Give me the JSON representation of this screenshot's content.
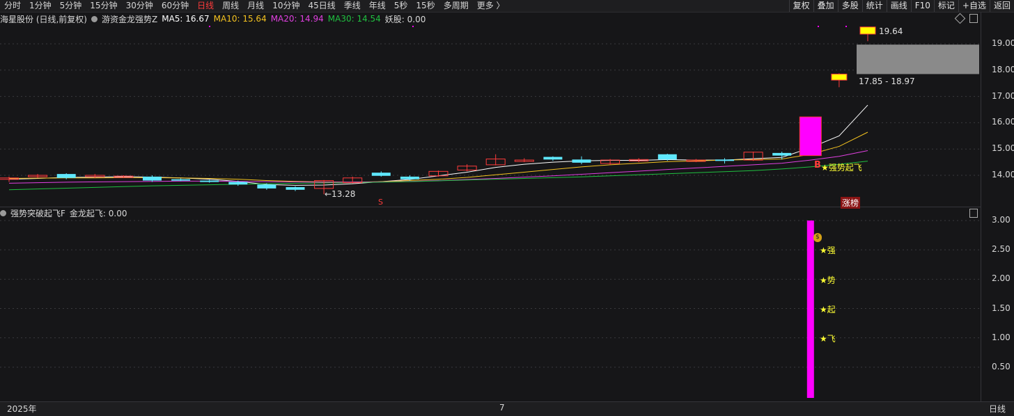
{
  "toolbar": {
    "periods": [
      "分时",
      "1分钟",
      "5分钟",
      "15分钟",
      "30分钟",
      "60分钟",
      "日线",
      "周线",
      "月线",
      "10分钟",
      "45日线",
      "季线",
      "年线",
      "5秒",
      "15秒",
      "多周期",
      "更多 〉"
    ],
    "active_period": "日线",
    "tools": [
      "复权",
      "叠加",
      "多股",
      "统计",
      "画线",
      "F10",
      "标记",
      "+自选",
      "返回"
    ]
  },
  "main_legend": {
    "stock": "海星股份 (日线,前复权)",
    "indicator": "游资金龙强势Z",
    "ma5": "MA5: 16.67",
    "ma10": "MA10: 15.64",
    "ma20": "MA20: 14.94",
    "ma30": "MA30: 14.54",
    "yaogu": "妖股: 0.00"
  },
  "sub_legend": {
    "name": "强势突破起飞F",
    "value": "金龙起飞: 0.00"
  },
  "colors": {
    "ma5": "#ffffff",
    "ma10": "#f5c320",
    "ma20": "#e040e0",
    "ma30": "#20c040",
    "up": "#ff3b3b",
    "down": "#5fe8ff",
    "magenta": "#ff00ff",
    "yellow": "#ffff00"
  },
  "annotations": {
    "low_price": "←13.28",
    "high_price": "19.64",
    "gap_range": "17.85 - 18.97",
    "signal_b": "B",
    "signal_text": "★强势起飞",
    "s_mark": "S",
    "zhangbang": "涨榜",
    "ind_chars": [
      "★强",
      "★势",
      "★起",
      "★飞"
    ]
  },
  "time_axis": {
    "year": "2025年",
    "month": "7",
    "period": "日线"
  },
  "chart_data": [
    {
      "type": "candlestick",
      "title": "海星股份 (日线,前复权)",
      "y_ticks": [
        "19.00",
        "18.00",
        "17.00",
        "16.00",
        "15.00",
        "14.00"
      ],
      "ylim": [
        13.0,
        19.9
      ],
      "candles": [
        {
          "o": 13.85,
          "c": 13.9,
          "h": 13.95,
          "l": 13.75
        },
        {
          "o": 13.95,
          "c": 14.0,
          "h": 14.05,
          "l": 13.9
        },
        {
          "o": 14.05,
          "c": 13.9,
          "h": 14.08,
          "l": 13.85
        },
        {
          "o": 13.95,
          "c": 14.0,
          "h": 14.05,
          "l": 13.9
        },
        {
          "o": 13.95,
          "c": 13.97,
          "h": 14.0,
          "l": 13.9
        },
        {
          "o": 13.95,
          "c": 13.8,
          "h": 14.0,
          "l": 13.75
        },
        {
          "o": 13.85,
          "c": 13.82,
          "h": 13.88,
          "l": 13.78
        },
        {
          "o": 13.8,
          "c": 13.78,
          "h": 13.83,
          "l": 13.72
        },
        {
          "o": 13.75,
          "c": 13.65,
          "h": 13.8,
          "l": 13.6
        },
        {
          "o": 13.65,
          "c": 13.5,
          "h": 13.7,
          "l": 13.45
        },
        {
          "o": 13.55,
          "c": 13.45,
          "h": 13.58,
          "l": 13.4
        },
        {
          "o": 13.5,
          "c": 13.8,
          "h": 13.82,
          "l": 13.28
        },
        {
          "o": 13.72,
          "c": 13.9,
          "h": 13.95,
          "l": 13.7
        },
        {
          "o": 14.1,
          "c": 13.98,
          "h": 14.15,
          "l": 13.95
        },
        {
          "o": 13.95,
          "c": 13.85,
          "h": 14.0,
          "l": 13.8
        },
        {
          "o": 13.98,
          "c": 14.15,
          "h": 14.18,
          "l": 13.95
        },
        {
          "o": 14.2,
          "c": 14.35,
          "h": 14.42,
          "l": 14.15
        },
        {
          "o": 14.4,
          "c": 14.62,
          "h": 14.8,
          "l": 14.38
        },
        {
          "o": 14.55,
          "c": 14.58,
          "h": 14.65,
          "l": 14.5
        },
        {
          "o": 14.7,
          "c": 14.6,
          "h": 14.72,
          "l": 14.55
        },
        {
          "o": 14.6,
          "c": 14.48,
          "h": 14.72,
          "l": 14.42
        },
        {
          "o": 14.45,
          "c": 14.58,
          "h": 14.62,
          "l": 14.4
        },
        {
          "o": 14.55,
          "c": 14.6,
          "h": 14.65,
          "l": 14.5
        },
        {
          "o": 14.8,
          "c": 14.6,
          "h": 14.82,
          "l": 14.55
        },
        {
          "o": 14.55,
          "c": 14.58,
          "h": 14.62,
          "l": 14.5
        },
        {
          "o": 14.6,
          "c": 14.55,
          "h": 14.65,
          "l": 14.45
        },
        {
          "o": 14.58,
          "c": 14.88,
          "h": 14.9,
          "l": 14.55
        },
        {
          "o": 14.85,
          "c": 14.75,
          "h": 14.9,
          "l": 14.6
        },
        {
          "o": 14.75,
          "c": 16.22,
          "h": 16.22,
          "l": 14.75
        },
        {
          "o": 17.85,
          "c": 17.7,
          "h": 17.88,
          "l": 17.35
        },
        {
          "o": 19.64,
          "c": 19.45,
          "h": 19.64,
          "l": 19.1
        }
      ],
      "ma5": [
        13.85,
        13.88,
        13.92,
        13.93,
        13.95,
        13.93,
        13.9,
        13.85,
        13.77,
        13.65,
        13.62,
        13.63,
        13.68,
        13.76,
        13.84,
        13.98,
        14.12,
        14.3,
        14.42,
        14.5,
        14.55,
        14.57,
        14.57,
        14.6,
        14.58,
        14.58,
        14.63,
        14.68,
        15.05,
        15.5,
        16.67
      ],
      "ma10": [
        13.88,
        13.89,
        13.9,
        13.9,
        13.91,
        13.91,
        13.9,
        13.88,
        13.85,
        13.8,
        13.77,
        13.75,
        13.74,
        13.76,
        13.8,
        13.85,
        13.92,
        14.02,
        14.12,
        14.22,
        14.32,
        14.4,
        14.46,
        14.52,
        14.55,
        14.58,
        14.6,
        14.62,
        14.8,
        15.1,
        15.64
      ],
      "ma20": [
        13.7,
        13.72,
        13.74,
        13.75,
        13.76,
        13.77,
        13.78,
        13.78,
        13.77,
        13.76,
        13.75,
        13.74,
        13.74,
        13.75,
        13.77,
        13.8,
        13.84,
        13.88,
        13.93,
        13.98,
        14.04,
        14.1,
        14.16,
        14.22,
        14.28,
        14.34,
        14.4,
        14.46,
        14.58,
        14.72,
        14.94
      ],
      "ma30": [
        13.45,
        13.48,
        13.51,
        13.54,
        13.57,
        13.6,
        13.62,
        13.64,
        13.66,
        13.68,
        13.7,
        13.71,
        13.72,
        13.74,
        13.76,
        13.79,
        13.82,
        13.85,
        13.88,
        13.91,
        13.94,
        13.98,
        14.02,
        14.06,
        14.1,
        14.14,
        14.18,
        14.24,
        14.32,
        14.42,
        14.54
      ],
      "gap": [
        17.85,
        18.97
      ]
    },
    {
      "type": "bar",
      "title": "强势突破起飞F",
      "y_ticks": [
        "3.00",
        "2.50",
        "2.00",
        "1.50",
        "1.00",
        "0.50"
      ],
      "ylim": [
        0,
        3.0
      ],
      "signal_value": 3.0,
      "signal_index": 28
    }
  ]
}
